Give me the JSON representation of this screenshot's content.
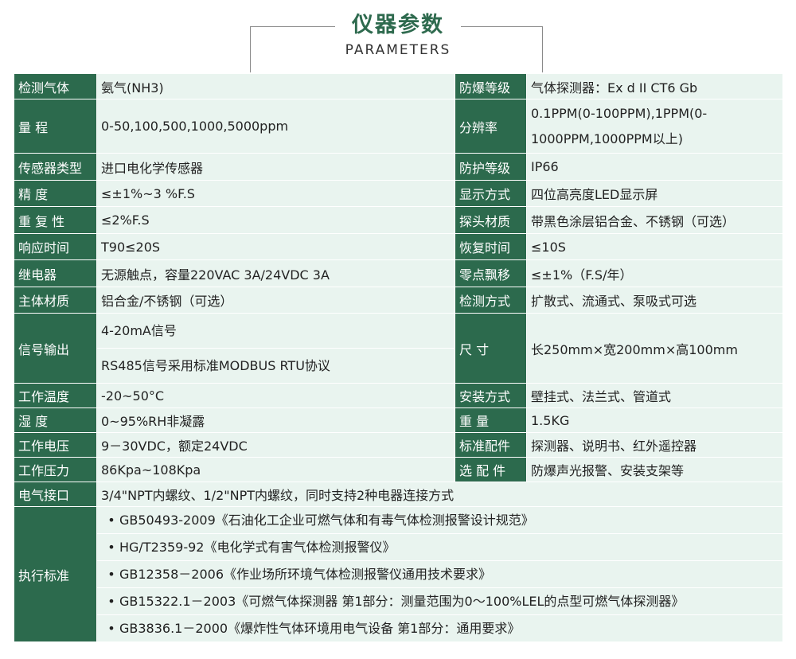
{
  "header": {
    "title": "仪器参数",
    "subtitle": "PARAMETERS"
  },
  "rows": [
    {
      "lk": "检测气体",
      "lv": "氨气(NH3)",
      "rk": "防爆等级",
      "rv": "气体探测器：Ex d II CT6 Gb"
    },
    {
      "lk": "量  程",
      "lv": "0-50,100,500,1000,5000ppm",
      "rk": "分辨率",
      "rv": "0.1PPM(0-100PPM),1PPM(0-1000PPM,1000PPM以上)"
    },
    {
      "lk": "传感器类型",
      "lv": "进口电化学传感器",
      "rk": "防护等级",
      "rv": "IP66"
    },
    {
      "lk": "精  度",
      "lv": "≤±1%~3 %F.S",
      "rk": "显示方式",
      "rv": "四位高亮度LED显示屏"
    },
    {
      "lk": "重 复 性",
      "lv": "≤2%F.S",
      "rk": "探头材质",
      "rv": "带黑色涂层铝合金、不锈钢（可选）"
    },
    {
      "lk": "响应时间",
      "lv": "T90≤20S",
      "rk": "恢复时间",
      "rv": "≤10S"
    },
    {
      "lk": "继电器",
      "lv": "无源触点，容量220VAC 3A/24VDC 3A",
      "rk": "零点飘移",
      "rv": "≤±1%（F.S/年）"
    },
    {
      "lk": "主体材质",
      "lv": "铝合金/不锈钢（可选）",
      "rk": "检测方式",
      "rv": "扩散式、流通式、泵吸式可选"
    },
    {
      "lk": "信号输出",
      "lv1": "4-20mA信号",
      "lv2": "RS485信号采用标准MODBUS RTU协议",
      "rk": "尺  寸",
      "rv": "长250mm×宽200mm×高100mm"
    },
    {
      "lk": "工作温度",
      "lv": "-20~50°C",
      "rk": "安装方式",
      "rv": "壁挂式、法兰式、管道式"
    },
    {
      "lk": "湿  度",
      "lv": "0~95%RH非凝露",
      "rk": "重  量",
      "rv": "1.5KG"
    },
    {
      "lk": "工作电压",
      "lv": "9－30VDC，额定24VDC",
      "rk": "标准配件",
      "rv": "探测器、说明书、红外遥控器"
    },
    {
      "lk": "工作压力",
      "lv": "86Kpa~108Kpa",
      "rk": "选 配 件",
      "rv": "防爆声光报警、安装支架等"
    },
    {
      "lk": "电气接口",
      "lv": "3/4\"NPT内螺纹、1/2\"NPT内螺纹，同时支持2种电器连接方式"
    },
    {
      "lk": "执行标准",
      "standards": [
        "GB50493-2009《石油化工企业可燃气体和有毒气体检测报警设计规范》",
        "HG/T2359-92《电化学式有害气体检测报警仪》",
        "GB12358－2006《作业场所环境气体检测报警仪通用技术要求》",
        "GB15322.1－2003《可燃气体探测器 第1部分：测量范围为0～100%LEL的点型可燃气体探测器》",
        "GB3836.1－2000《爆炸性气体环境用电气设备 第1部分：通用要求》"
      ]
    }
  ],
  "bullet": "•",
  "colors": {
    "key_bg": "#2c6a4d",
    "value_bg": "#e9f4ef",
    "title": "#2e6a4e"
  }
}
